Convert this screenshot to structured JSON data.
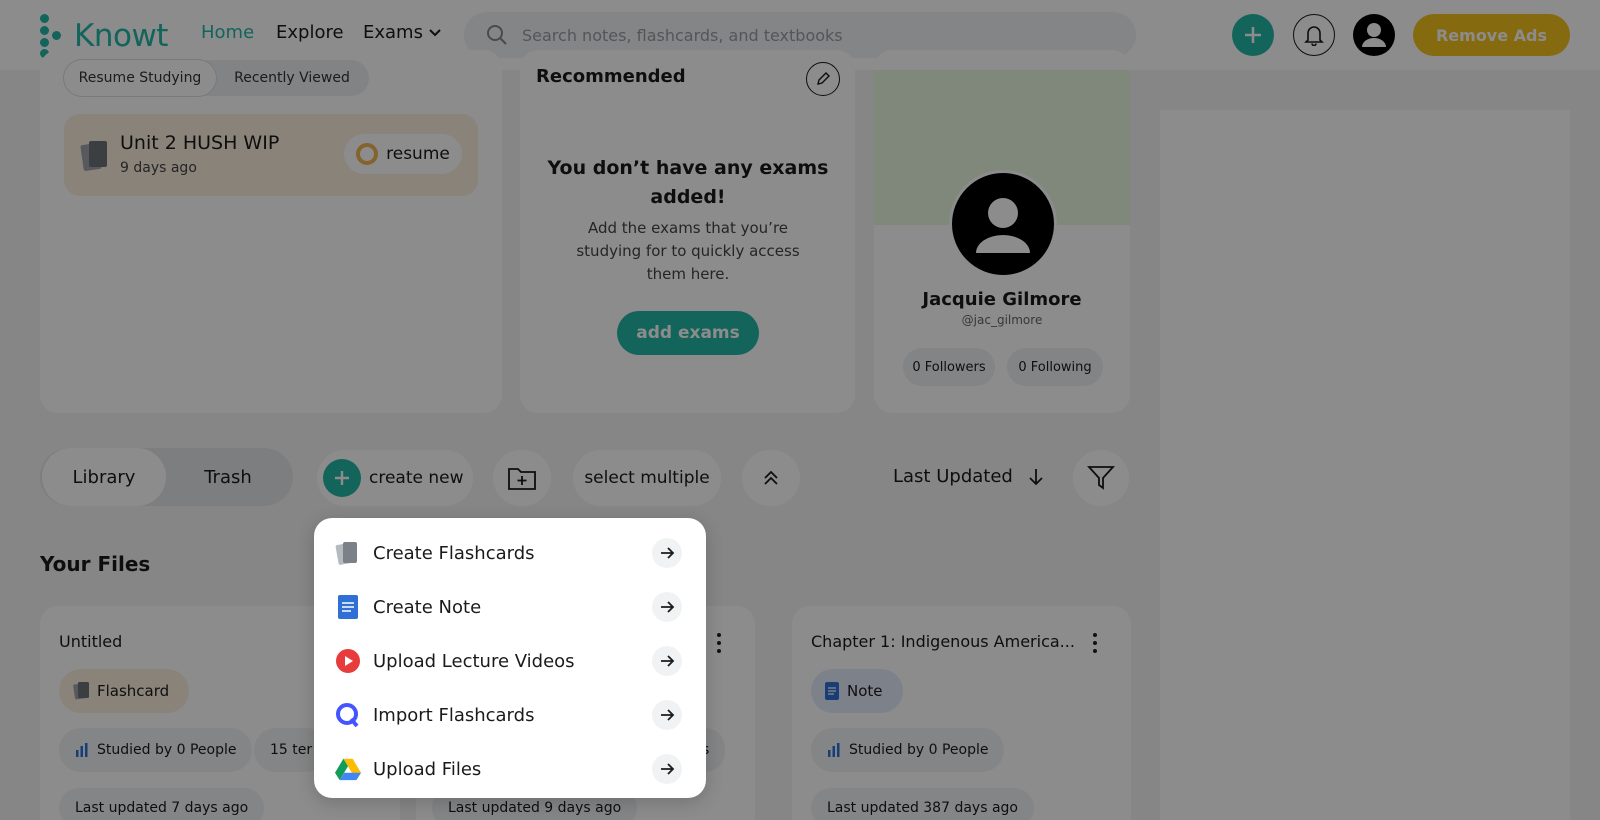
{
  "nav": {
    "logo_text": "Knowt",
    "home": "Home",
    "explore": "Explore",
    "exams": "Exams",
    "search_placeholder": "Search notes, flashcards, and textbooks",
    "remove_ads": "Remove Ads"
  },
  "resume_section": {
    "tabs": [
      "Resume Studying",
      "Recently Viewed"
    ],
    "item_title": "Unit 2 HUSH WIP",
    "item_time": "9 days ago",
    "resume_label": "resume"
  },
  "recommended": {
    "title": "Recommended",
    "empty_title": "You don’t have any exams added!",
    "empty_desc": "Add the exams that you’re studying for to quickly access them here.",
    "add_button": "add exams"
  },
  "profile": {
    "name": "Jacquie Gilmore",
    "handle": "@jac_gilmore",
    "followers": "0 Followers",
    "following": "0 Following"
  },
  "toolbar": {
    "library": "Library",
    "trash": "Trash",
    "create_new": "create new",
    "select_multiple": "select multiple",
    "sort_label": "Last Updated"
  },
  "files": {
    "title": "Your Files",
    "cards": [
      {
        "title": "Untitled",
        "type": "Flashcard",
        "studied": "Studied by 0 People",
        "terms": "15 ter",
        "updated": "Last updated 7 days ago"
      },
      {
        "title": "",
        "type": "",
        "studied": "",
        "terms": "s",
        "updated": "Last updated 9 days ago"
      },
      {
        "title": "Chapter 1: Indigenous America...",
        "type": "Note",
        "studied": "Studied by 0 People",
        "updated": "Last updated 387 days ago"
      }
    ]
  },
  "create_menu": {
    "items": [
      {
        "label": "Create Flashcards",
        "icon": "flashcards-icon"
      },
      {
        "label": "Create Note",
        "icon": "note-doc-icon"
      },
      {
        "label": "Upload Lecture Videos",
        "icon": "video-play-icon"
      },
      {
        "label": "Import Flashcards",
        "icon": "quizlet-icon"
      },
      {
        "label": "Upload Files",
        "icon": "google-drive-icon"
      }
    ]
  },
  "colors": {
    "brand": "#24b6a7",
    "ads": "#f5c11d"
  }
}
